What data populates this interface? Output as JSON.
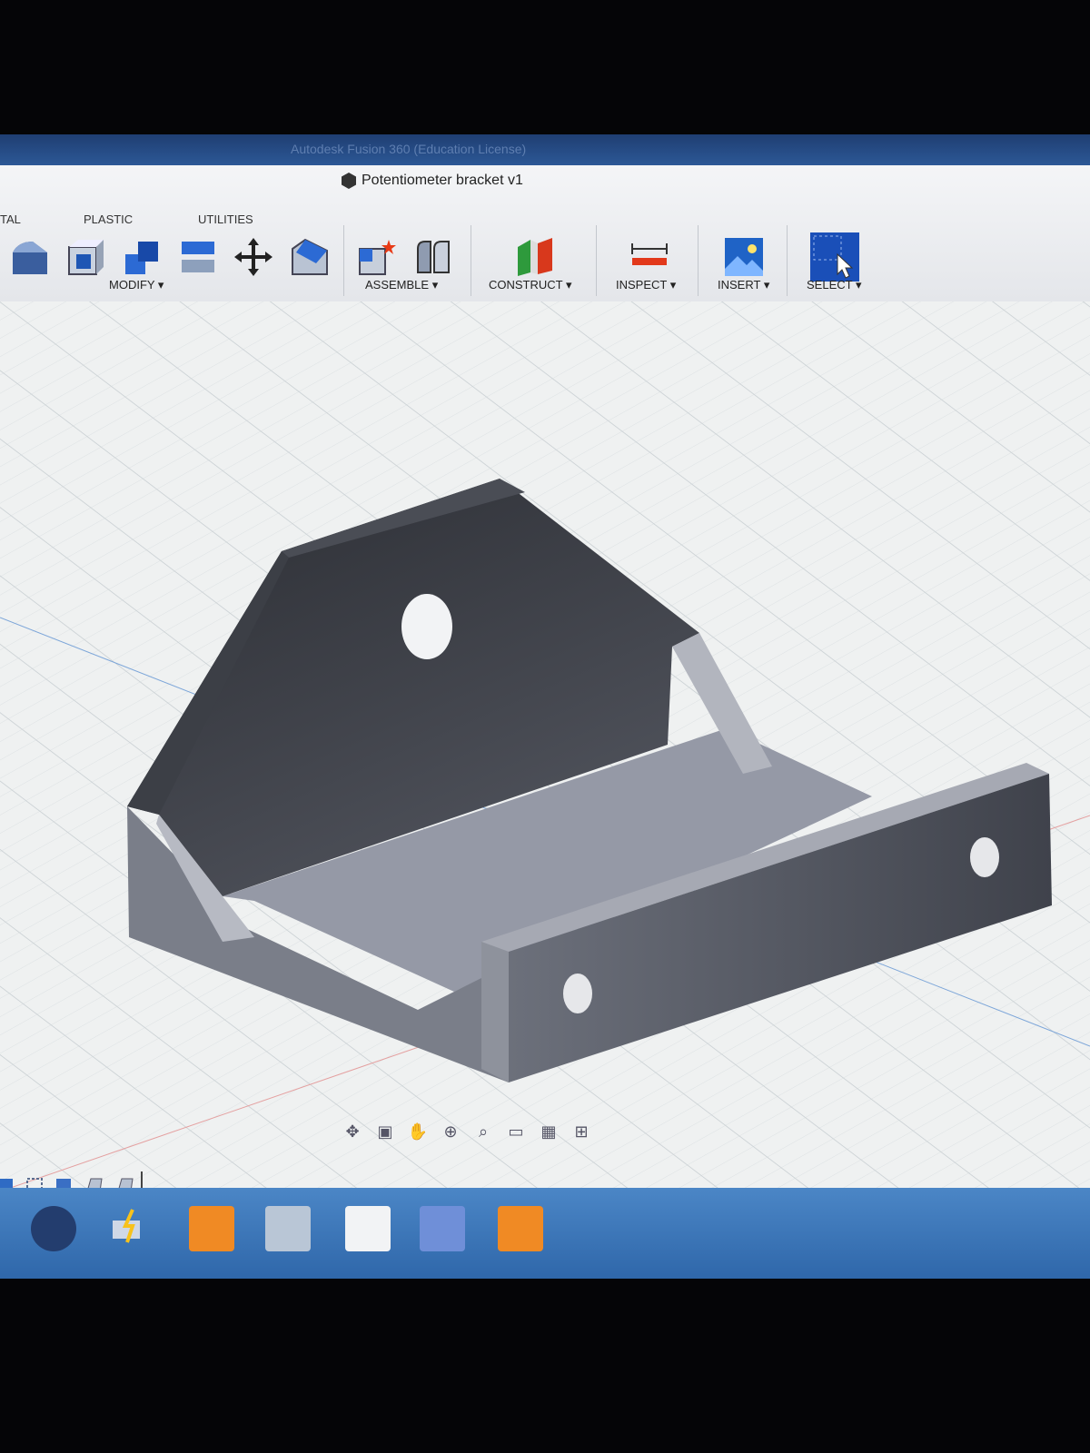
{
  "window": {
    "title": "Autodesk Fusion 360 (Education License)"
  },
  "document": {
    "title": "Potentiometer bracket v1"
  },
  "tabs": [
    {
      "label": "TAL"
    },
    {
      "label": "PLASTIC"
    },
    {
      "label": "UTILITIES"
    }
  ],
  "groups": {
    "modify": "MODIFY ▾",
    "assemble": "ASSEMBLE ▾",
    "construct": "CONSTRUCT ▾",
    "inspect": "INSPECT ▾",
    "insert": "INSERT ▾",
    "select": "SELECT ▾"
  },
  "icons": {
    "press_pull": "press-pull-icon",
    "shell": "shell-icon",
    "combine": "combine-icon",
    "split_body": "split-body-icon",
    "move": "move-icon",
    "chamfer": "chamfer-icon",
    "new_component": "new-component-icon",
    "joint": "joint-icon",
    "construct_plane": "construct-plane-icon",
    "measure": "measure-icon",
    "insert_image": "insert-image-icon",
    "select": "select-icon"
  },
  "navbar": [
    "orbit-icon",
    "look-at-icon",
    "pan-icon",
    "zoom-icon",
    "fit-icon",
    "display-settings-icon",
    "grid-icon",
    "viewports-icon"
  ],
  "taskbar": [
    "media-player-icon",
    "network-icon",
    "fusion-360-icon",
    "z-app-icon",
    "typora-icon",
    "settings-icon",
    "fusion-360-icon"
  ],
  "colors": {
    "accent": "#1f5fbf",
    "taskbar": "#3b74b8",
    "fusion_orange": "#f08a24"
  }
}
